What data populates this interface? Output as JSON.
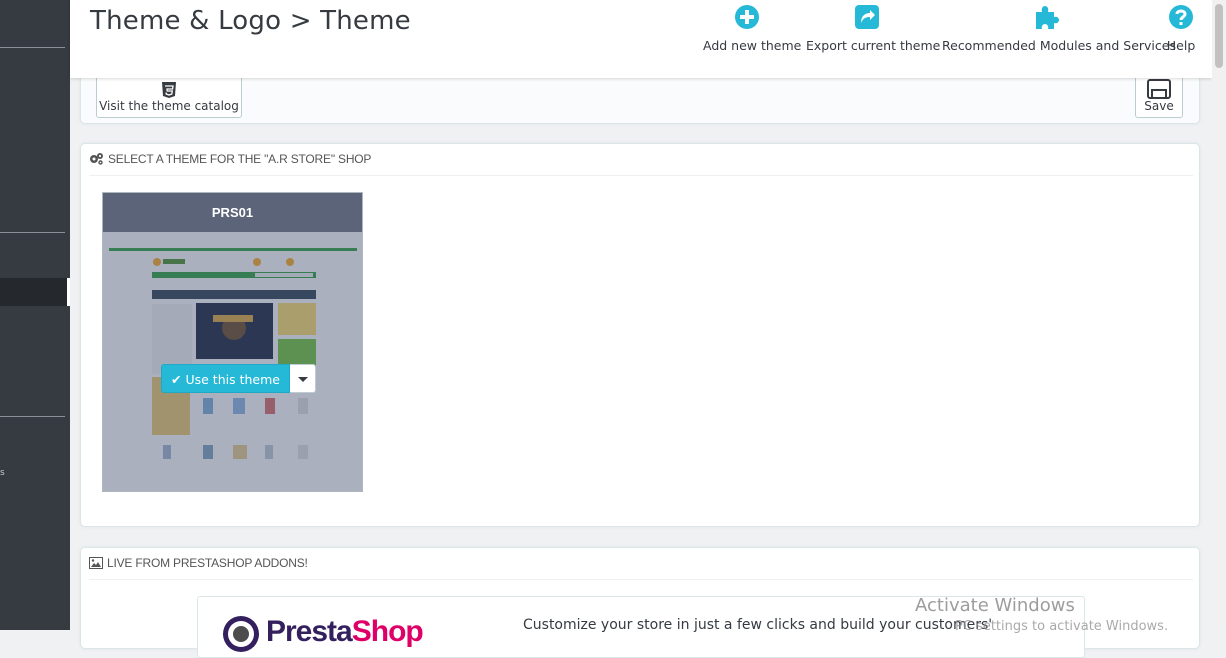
{
  "header": {
    "title": "Theme & Logo > Theme",
    "toolbar": [
      {
        "label": "Add new theme",
        "icon": "plus-circle-icon"
      },
      {
        "label": "Export current theme",
        "icon": "share-icon"
      },
      {
        "label": "Recommended Modules and Services",
        "icon": "puzzle-icon"
      },
      {
        "label": "Help",
        "icon": "question-circle-icon"
      }
    ]
  },
  "actions": {
    "catalog_label": "Visit the theme catalog",
    "save_label": "Save"
  },
  "theme_section": {
    "heading": "SELECT A THEME FOR THE \"A.R STORE\" SHOP",
    "theme": {
      "name": "PRS01",
      "use_label": "Use this theme"
    }
  },
  "addons_section": {
    "heading": "LIVE FROM PRESTASHOP ADDONS!",
    "logo_text_dark": "Presta",
    "logo_text_pink": "Shop",
    "description": "Customize your store in just a few clicks and build your customers'"
  },
  "sidebar": {
    "fragment": "s"
  },
  "watermark": {
    "title": "Activate Windows",
    "subtitle": "PC settings to activate Windows."
  },
  "colors": {
    "accent": "#25b9d7",
    "sidebar": "#363a41",
    "theme_header": "#5b6479"
  }
}
